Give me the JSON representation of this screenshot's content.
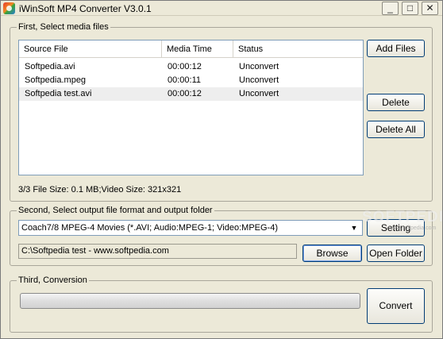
{
  "window": {
    "title": "iWinSoft MP4 Converter V3.0.1",
    "controls": {
      "minimize": "_",
      "maximize": "□",
      "close": "✕"
    }
  },
  "section1": {
    "label": "First, Select media files",
    "columns": [
      "Source File",
      "Media Time",
      "Status"
    ],
    "rows": [
      {
        "source": "Softpedia.avi",
        "time": "00:00:12",
        "status": "Unconvert"
      },
      {
        "source": "Softpedia.mpeg",
        "time": "00:00:11",
        "status": "Unconvert"
      },
      {
        "source": "Softpedia test.avi",
        "time": "00:00:12",
        "status": "Unconvert"
      }
    ],
    "buttons": {
      "add": "Add Files",
      "delete": "Delete",
      "delete_all": "Delete All"
    },
    "info": "3/3 File Size: 0.1 MB;Video Size: 321x321"
  },
  "section2": {
    "label": "Second, Select output file format and output folder",
    "format_selected": "Coach7/8 MPEG-4 Movies (*.AVI; Audio:MPEG-1; Video:MPEG-4)",
    "output_folder": "C:\\Softpedia test - www.softpedia.com",
    "buttons": {
      "setting": "Setting",
      "browse": "Browse",
      "open_folder": "Open Folder"
    }
  },
  "section3": {
    "label": "Third, Conversion",
    "progress": 0,
    "buttons": {
      "convert": "Convert"
    }
  },
  "watermark": {
    "text": "SOFTPEDIA",
    "url": "www.softpedia.com"
  },
  "colors": {
    "window_bg": "#ece9d8",
    "button_border": "#003c74",
    "list_border": "#7f9db9"
  }
}
